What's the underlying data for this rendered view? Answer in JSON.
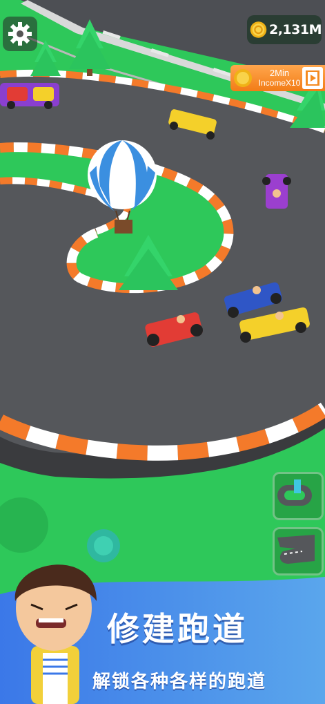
{
  "hud": {
    "coin_balance": "2,131M",
    "income_boost": {
      "duration": "2Min",
      "label": "IncomeX10"
    },
    "settings_icon": "gear-icon",
    "coin_icon": "coin-icon",
    "video_icon": "play-video-icon"
  },
  "track_thumbnails": [
    {
      "name": "track-thumbnail-1"
    },
    {
      "name": "track-thumbnail-2"
    }
  ],
  "banner": {
    "title": "修建跑道",
    "subtitle": "解锁各种各样的跑道"
  },
  "colors": {
    "grass": "#2ec85a",
    "track": "#55575b",
    "curb_orange": "#f47a2a",
    "curb_white": "#ffffff",
    "banner_blue": "#3f7de6",
    "coin_gold": "#f5c518",
    "income_orange": "#f48b20"
  }
}
